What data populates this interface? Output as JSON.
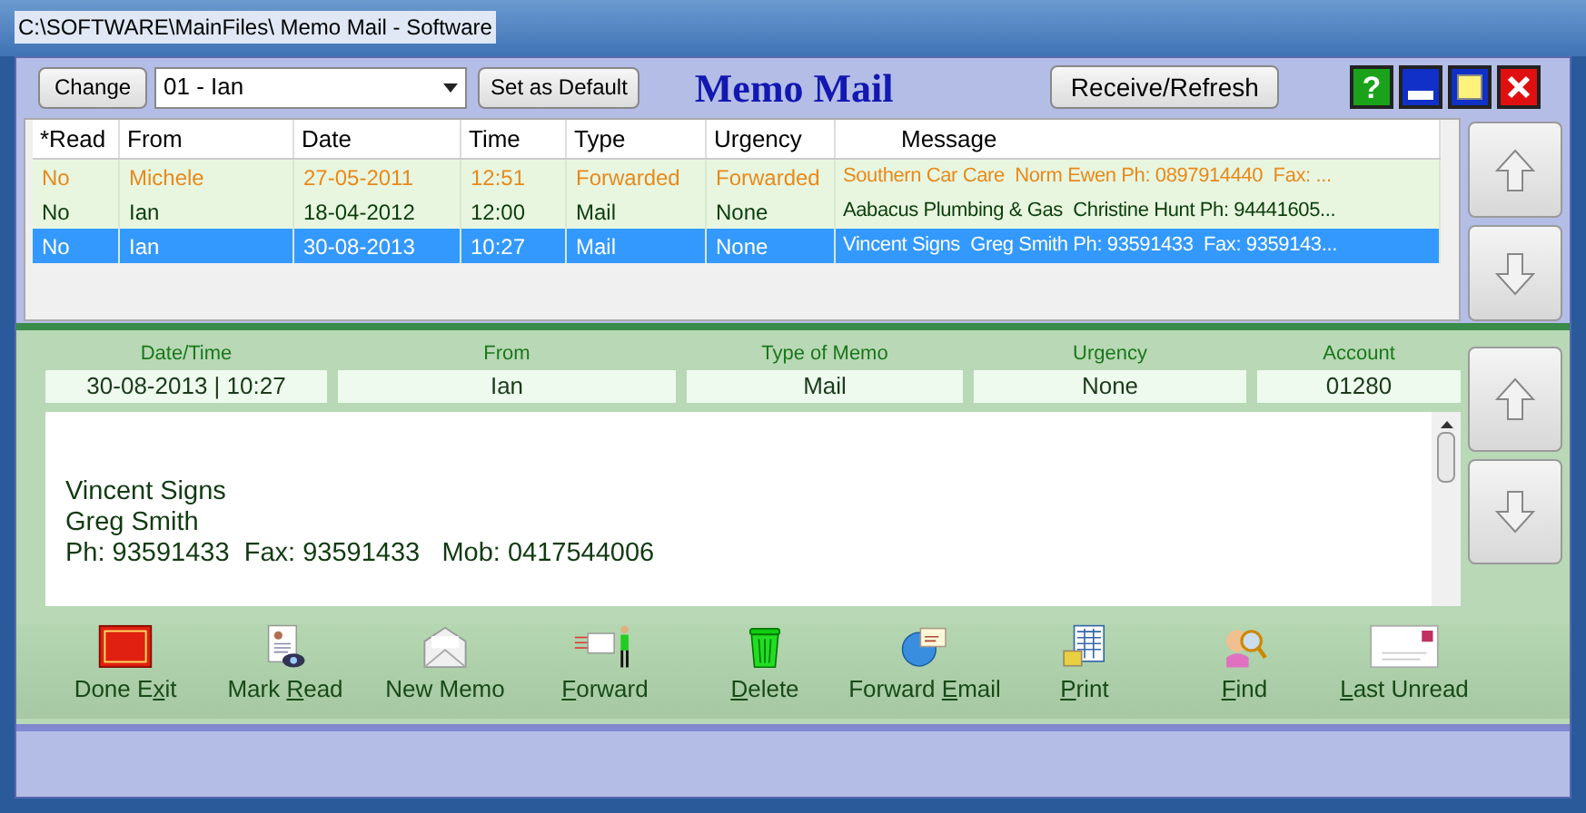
{
  "window": {
    "title": "C:\\SOFTWARE\\MainFiles\\ Memo Mail - Software"
  },
  "toolbar": {
    "change_button": "Change",
    "user_select": {
      "value": "01 - Ian"
    },
    "default_button": "Set as Default",
    "app_title": "Memo Mail",
    "refresh_button": "Receive/Refresh",
    "window_buttons": [
      {
        "kind": "help",
        "label": "?"
      },
      {
        "kind": "minimize"
      },
      {
        "kind": "maximize"
      },
      {
        "kind": "close"
      }
    ]
  },
  "table": {
    "columns": [
      "*Read",
      "From",
      "Date",
      "Time",
      "Type",
      "Urgency",
      "Message"
    ],
    "rows": [
      {
        "cells": [
          "No",
          "Michele",
          "27-05-2011",
          "12:51",
          "Forwarded",
          "Forwarded",
          "Southern Car Care  Norm Ewen Ph: 0897914440  Fax: ..."
        ],
        "color": "#e8891a",
        "selected": false
      },
      {
        "cells": [
          "No",
          "Ian",
          "18-04-2012",
          "12:00",
          "Mail",
          "None",
          "Aabacus Plumbing & Gas  Christine Hunt Ph: 94441605..."
        ],
        "color": "#0a3d0a",
        "selected": false
      },
      {
        "cells": [
          "No",
          "Ian",
          "30-08-2013",
          "10:27",
          "Mail",
          "None",
          "Vincent Signs  Greg Smith Ph: 93591433  Fax: 9359143..."
        ],
        "selected": true
      }
    ]
  },
  "details": {
    "fields": [
      {
        "label": "Date/Time",
        "value": "30-08-2013 | 10:27"
      },
      {
        "label": "From",
        "value": "Ian"
      },
      {
        "label": "Type of Memo",
        "value": "Mail"
      },
      {
        "label": "Urgency",
        "value": "None"
      },
      {
        "label": "Account",
        "value": "01280"
      }
    ],
    "message_lines": [
      "Vincent Signs",
      "Greg Smith",
      "Ph: 93591433  Fax: 93591433   Mob: 0417544006"
    ]
  },
  "actions": [
    {
      "kind": "exit",
      "before": "Done E",
      "key": "x",
      "after": "it"
    },
    {
      "kind": "mark-read",
      "before": "Mark ",
      "key": "R",
      "after": "ead"
    },
    {
      "kind": "new",
      "before": "New Memo"
    },
    {
      "kind": "forward",
      "key": "F",
      "after": "orward"
    },
    {
      "kind": "delete",
      "key": "D",
      "after": "elete"
    },
    {
      "kind": "email",
      "before": "Forward ",
      "key": "E",
      "after": "mail"
    },
    {
      "kind": "print",
      "key": "P",
      "after": "rint"
    },
    {
      "kind": "find",
      "key": "F",
      "after": "ind"
    },
    {
      "kind": "last",
      "key": "L",
      "after": "ast Unread"
    }
  ]
}
